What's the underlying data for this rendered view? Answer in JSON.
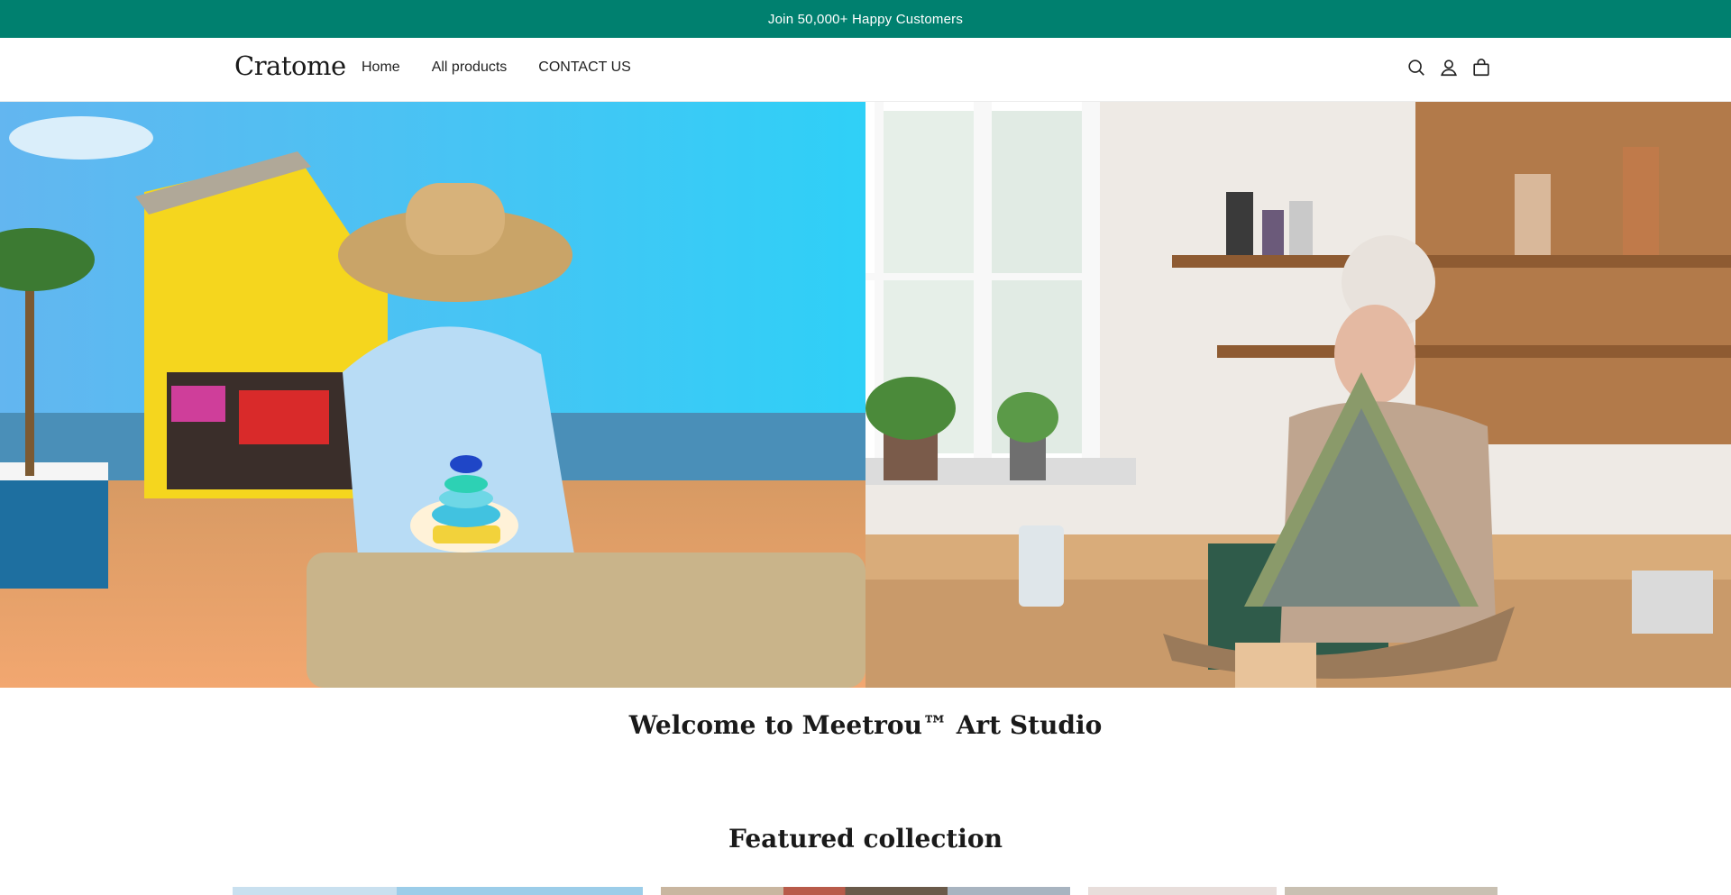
{
  "announcement": {
    "text": "Join 50,000+ Happy Customers"
  },
  "header": {
    "logo": "Cratome",
    "nav": [
      {
        "label": "Home"
      },
      {
        "label": "All products"
      },
      {
        "label": "CONTACT US"
      }
    ],
    "icons": [
      "search-icon",
      "account-icon",
      "cart-icon"
    ]
  },
  "hero": {
    "left_image": "woman stacking sea glass on driftwood at beach gift shop",
    "right_image": "woman making sea glass mosaic boat in craft workshop"
  },
  "welcome": {
    "heading": "Welcome to Meetrou™ Art Studio"
  },
  "featured": {
    "heading": "Featured collection"
  },
  "colors": {
    "accent": "#00806f",
    "text": "#121212",
    "background": "#ffffff"
  }
}
